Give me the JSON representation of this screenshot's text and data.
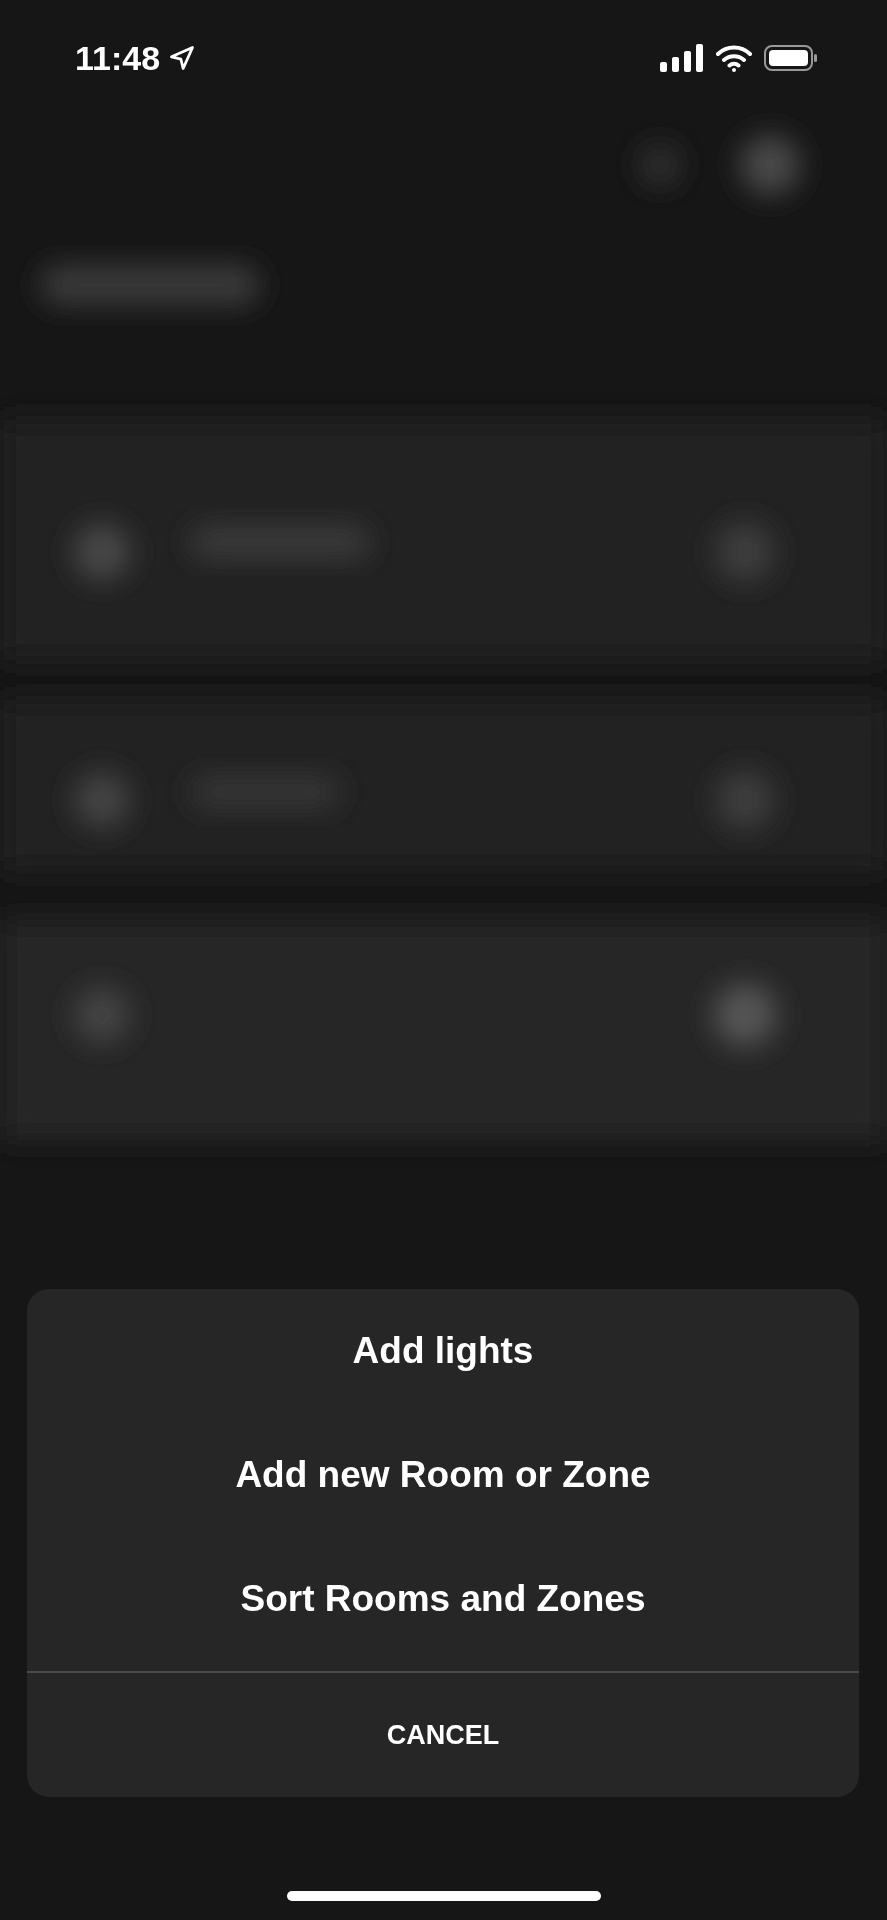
{
  "status_bar": {
    "time": "11:48"
  },
  "action_sheet": {
    "actions": [
      {
        "label": "Add lights"
      },
      {
        "label": "Add new Room or Zone"
      },
      {
        "label": "Sort Rooms and Zones"
      }
    ],
    "cancel": "CANCEL"
  }
}
